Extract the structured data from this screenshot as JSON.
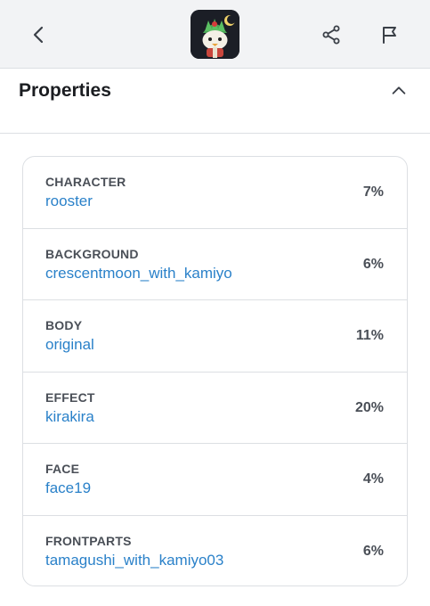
{
  "header": {
    "back_icon": "chevron-left-icon",
    "share_icon": "share-icon",
    "flag_icon": "flag-icon",
    "avatar": "nft-thumbnail"
  },
  "properties": {
    "title": "Properties",
    "toggle_icon": "chevron-up-icon",
    "items": [
      {
        "type": "CHARACTER",
        "value": "rooster",
        "percent": "7%"
      },
      {
        "type": "BACKGROUND",
        "value": "crescentmoon_with_kamiyo",
        "percent": "6%"
      },
      {
        "type": "BODY",
        "value": "original",
        "percent": "11%"
      },
      {
        "type": "EFFECT",
        "value": "kirakira",
        "percent": "20%"
      },
      {
        "type": "FACE",
        "value": "face19",
        "percent": "4%"
      },
      {
        "type": "FRONTPARTS",
        "value": "tamagushi_with_kamiyo03",
        "percent": "6%"
      }
    ]
  },
  "colors": {
    "link": "#2a81c9",
    "header_bg": "#f2f3f5",
    "border": "#dcdfe3"
  }
}
